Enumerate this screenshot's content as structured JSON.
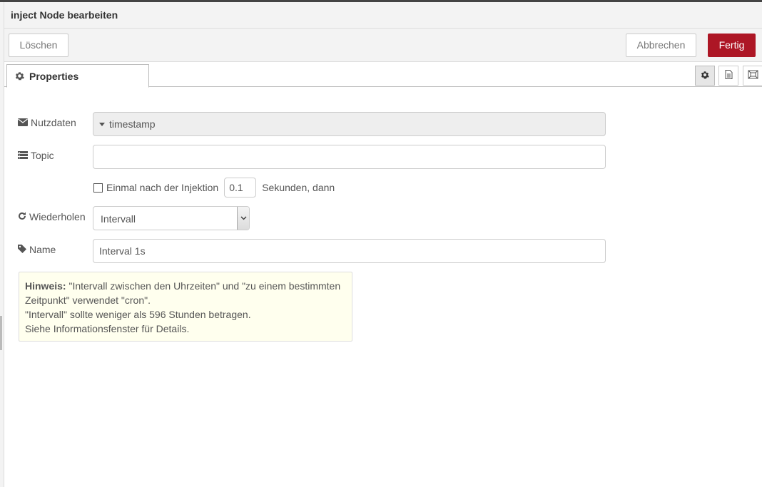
{
  "dialog": {
    "title": "inject Node bearbeiten"
  },
  "actions": {
    "delete": "Löschen",
    "cancel": "Abbrechen",
    "done": "Fertig"
  },
  "tabs": {
    "properties": "Properties"
  },
  "form": {
    "payload": {
      "label": "Nutzdaten",
      "value": "timestamp"
    },
    "topic": {
      "label": "Topic",
      "value": ""
    },
    "once": {
      "label": "Einmal nach der Injektion",
      "delay": "0.1",
      "suffix": "Sekunden, dann",
      "checked": false
    },
    "repeat": {
      "label": "Wiederholen",
      "value": "Intervall"
    },
    "name": {
      "label": "Name",
      "value": "Interval 1s"
    }
  },
  "tip": {
    "bold": "Hinweis:",
    "line1": " \"Intervall zwischen den Uhrzeiten\" und \"zu einem bestimmten",
    "line2": "Zeitpunkt\" verwendet \"cron\".",
    "line3": "\"Intervall\" sollte weniger als 596 Stunden betragen.",
    "line4": "Siehe Informationsfenster für Details."
  },
  "colors": {
    "primary": "#ad1625",
    "tip_background": "#ffffee",
    "panel": "#f3f3f3"
  },
  "icons": [
    "cog-icon",
    "file-text-icon",
    "object-ungroup-icon",
    "envelope-icon",
    "tasks-icon",
    "repeat-icon",
    "tag-icon",
    "caret-down-icon",
    "chevron-down-icon"
  ]
}
